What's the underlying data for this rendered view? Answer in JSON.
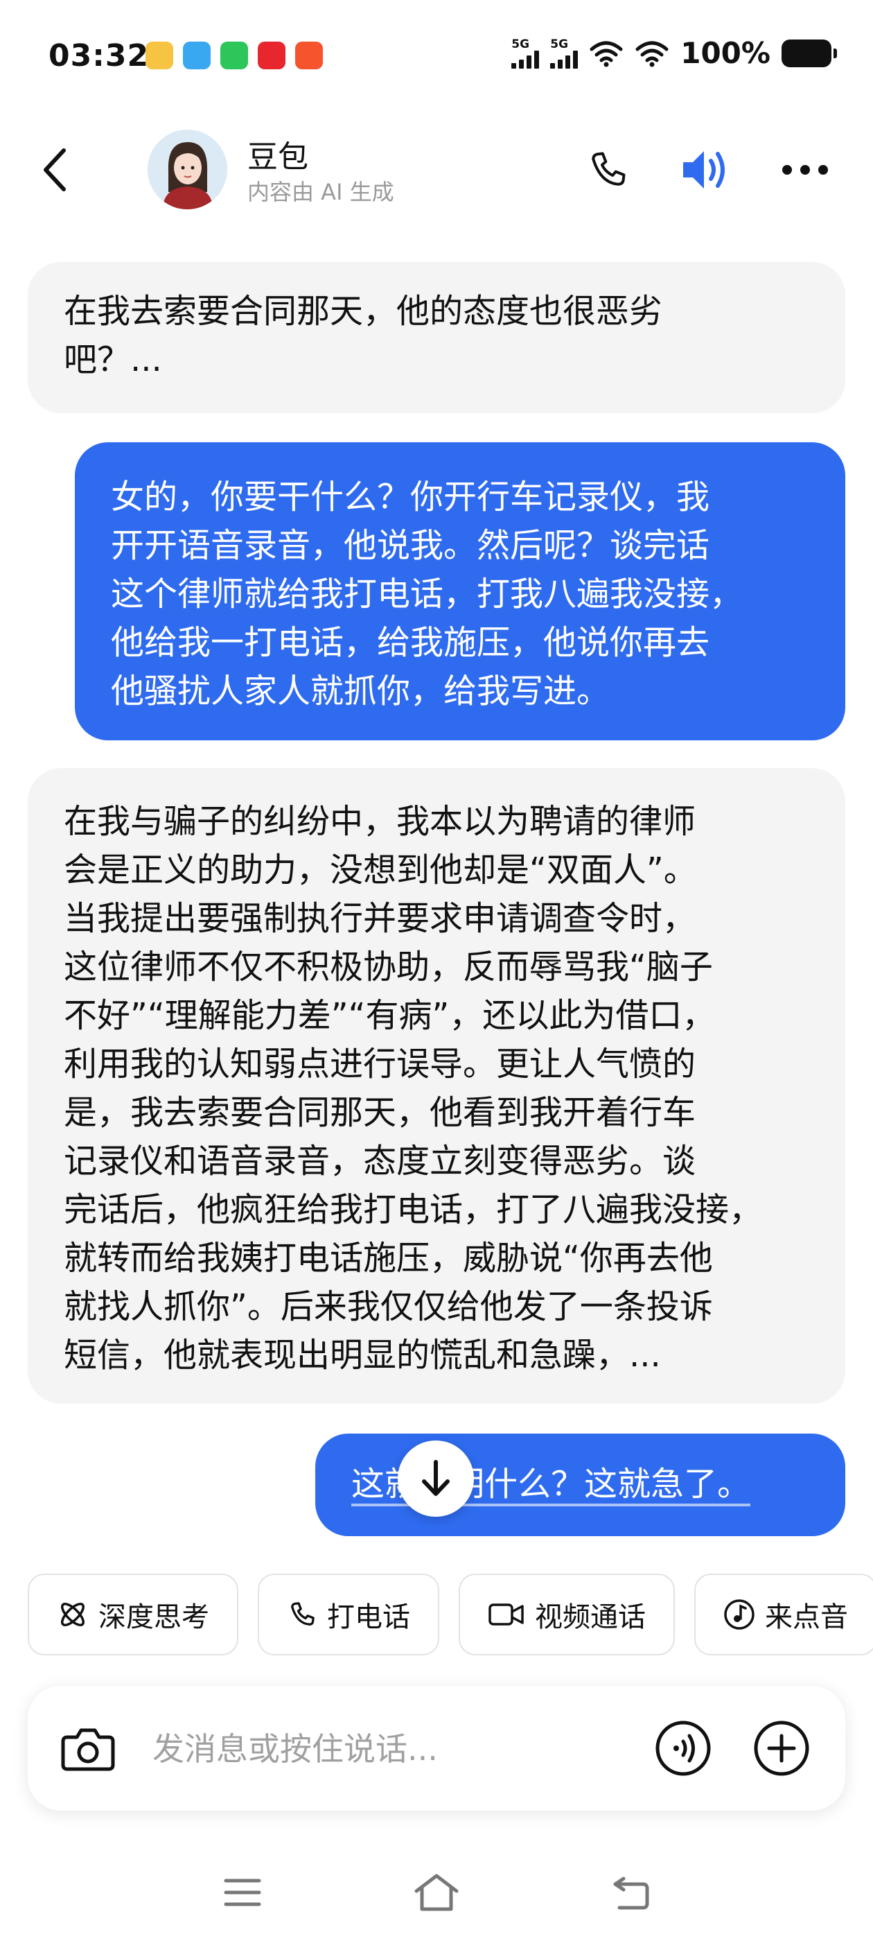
{
  "status_bar": {
    "time": "03:32",
    "signal_1": "5G",
    "signal_2": "5G",
    "battery": "100%",
    "app_icons": [
      "notification-icon",
      "app-icon-blue",
      "wechat-icon",
      "app-icon-red",
      "app-icon-orange"
    ]
  },
  "header": {
    "name": "豆包",
    "subtitle": "内容由 AI 生成",
    "icons": [
      "back-icon",
      "phone-icon",
      "speaker-icon",
      "more-icon"
    ],
    "accent_color": "#2f6bef"
  },
  "messages": [
    {
      "role": "bot",
      "text": "在我去索要合同那天，他的态度也很恶劣\n吧？..."
    },
    {
      "role": "user",
      "text": "女的，你要干什么？你开行车记录仪，我\n开开语音录音，他说我。然后呢？谈完话\n这个律师就给我打电话，打我八遍我没接，\n他给我一打电话，给我施压，他说你再去\n他骚扰人家人就抓你，给我写进。"
    },
    {
      "role": "bot",
      "text": "在我与骗子的纠纷中，我本以为聘请的律师\n会是正义的助力，没想到他却是“双面人”。\n当我提出要强制执行并要求申请调查令时，\n这位律师不仅不积极协助，反而辱骂我“脑子\n不好”“理解能力差”“有病”，还以此为借口，\n利用我的认知弱点进行误导。更让人气愤的\n是，我去索要合同那天，他看到我开着行车\n记录仪和语音录音，态度立刻变得恶劣。谈\n完话后，他疯狂给我打电话，打了八遍我没接，\n就转而给我姨打电话施压，威胁说“你再去他\n就找人抓你”。后来我仅仅给他发了一条投诉\n短信，他就表现出明显的慌乱和急躁，..."
    },
    {
      "role": "user",
      "text": "这就说明什么？这就急了。"
    }
  ],
  "quick_actions": [
    {
      "label": "深度思考",
      "icon": "atom-icon"
    },
    {
      "label": "打电话",
      "icon": "phone-icon"
    },
    {
      "label": "视频通话",
      "icon": "video-icon"
    },
    {
      "label": "来点音",
      "icon": "music-note-icon"
    }
  ],
  "input": {
    "placeholder": "发消息或按住说话..."
  }
}
